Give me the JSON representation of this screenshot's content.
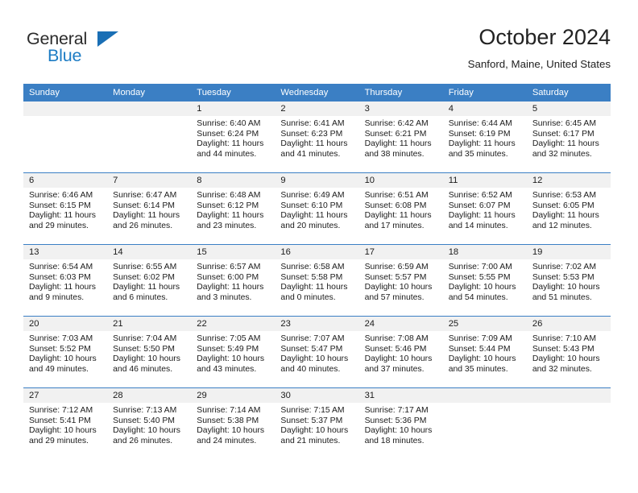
{
  "brand": {
    "word_one": "General",
    "word_two": "Blue",
    "triangle_color": "#1a6fb5"
  },
  "header": {
    "month_title": "October 2024",
    "location": "Sanford, Maine, United States"
  },
  "theme": {
    "header_blue": "#3b7fc4",
    "daynum_band": "#f1f1f1",
    "text": "#1b1b1b"
  },
  "weekday_headers": [
    "Sunday",
    "Monday",
    "Tuesday",
    "Wednesday",
    "Thursday",
    "Friday",
    "Saturday"
  ],
  "labels": {
    "sunrise_prefix": "Sunrise: ",
    "sunset_prefix": "Sunset: ",
    "daylight_prefix": "Daylight: "
  },
  "weeks": [
    [
      {
        "day": "",
        "sunrise": "",
        "sunset": "",
        "daylight_line1": "",
        "daylight_line2": ""
      },
      {
        "day": "",
        "sunrise": "",
        "sunset": "",
        "daylight_line1": "",
        "daylight_line2": ""
      },
      {
        "day": "1",
        "sunrise": "Sunrise: 6:40 AM",
        "sunset": "Sunset: 6:24 PM",
        "daylight_line1": "Daylight: 11 hours",
        "daylight_line2": "and 44 minutes."
      },
      {
        "day": "2",
        "sunrise": "Sunrise: 6:41 AM",
        "sunset": "Sunset: 6:23 PM",
        "daylight_line1": "Daylight: 11 hours",
        "daylight_line2": "and 41 minutes."
      },
      {
        "day": "3",
        "sunrise": "Sunrise: 6:42 AM",
        "sunset": "Sunset: 6:21 PM",
        "daylight_line1": "Daylight: 11 hours",
        "daylight_line2": "and 38 minutes."
      },
      {
        "day": "4",
        "sunrise": "Sunrise: 6:44 AM",
        "sunset": "Sunset: 6:19 PM",
        "daylight_line1": "Daylight: 11 hours",
        "daylight_line2": "and 35 minutes."
      },
      {
        "day": "5",
        "sunrise": "Sunrise: 6:45 AM",
        "sunset": "Sunset: 6:17 PM",
        "daylight_line1": "Daylight: 11 hours",
        "daylight_line2": "and 32 minutes."
      }
    ],
    [
      {
        "day": "6",
        "sunrise": "Sunrise: 6:46 AM",
        "sunset": "Sunset: 6:15 PM",
        "daylight_line1": "Daylight: 11 hours",
        "daylight_line2": "and 29 minutes."
      },
      {
        "day": "7",
        "sunrise": "Sunrise: 6:47 AM",
        "sunset": "Sunset: 6:14 PM",
        "daylight_line1": "Daylight: 11 hours",
        "daylight_line2": "and 26 minutes."
      },
      {
        "day": "8",
        "sunrise": "Sunrise: 6:48 AM",
        "sunset": "Sunset: 6:12 PM",
        "daylight_line1": "Daylight: 11 hours",
        "daylight_line2": "and 23 minutes."
      },
      {
        "day": "9",
        "sunrise": "Sunrise: 6:49 AM",
        "sunset": "Sunset: 6:10 PM",
        "daylight_line1": "Daylight: 11 hours",
        "daylight_line2": "and 20 minutes."
      },
      {
        "day": "10",
        "sunrise": "Sunrise: 6:51 AM",
        "sunset": "Sunset: 6:08 PM",
        "daylight_line1": "Daylight: 11 hours",
        "daylight_line2": "and 17 minutes."
      },
      {
        "day": "11",
        "sunrise": "Sunrise: 6:52 AM",
        "sunset": "Sunset: 6:07 PM",
        "daylight_line1": "Daylight: 11 hours",
        "daylight_line2": "and 14 minutes."
      },
      {
        "day": "12",
        "sunrise": "Sunrise: 6:53 AM",
        "sunset": "Sunset: 6:05 PM",
        "daylight_line1": "Daylight: 11 hours",
        "daylight_line2": "and 12 minutes."
      }
    ],
    [
      {
        "day": "13",
        "sunrise": "Sunrise: 6:54 AM",
        "sunset": "Sunset: 6:03 PM",
        "daylight_line1": "Daylight: 11 hours",
        "daylight_line2": "and 9 minutes."
      },
      {
        "day": "14",
        "sunrise": "Sunrise: 6:55 AM",
        "sunset": "Sunset: 6:02 PM",
        "daylight_line1": "Daylight: 11 hours",
        "daylight_line2": "and 6 minutes."
      },
      {
        "day": "15",
        "sunrise": "Sunrise: 6:57 AM",
        "sunset": "Sunset: 6:00 PM",
        "daylight_line1": "Daylight: 11 hours",
        "daylight_line2": "and 3 minutes."
      },
      {
        "day": "16",
        "sunrise": "Sunrise: 6:58 AM",
        "sunset": "Sunset: 5:58 PM",
        "daylight_line1": "Daylight: 11 hours",
        "daylight_line2": "and 0 minutes."
      },
      {
        "day": "17",
        "sunrise": "Sunrise: 6:59 AM",
        "sunset": "Sunset: 5:57 PM",
        "daylight_line1": "Daylight: 10 hours",
        "daylight_line2": "and 57 minutes."
      },
      {
        "day": "18",
        "sunrise": "Sunrise: 7:00 AM",
        "sunset": "Sunset: 5:55 PM",
        "daylight_line1": "Daylight: 10 hours",
        "daylight_line2": "and 54 minutes."
      },
      {
        "day": "19",
        "sunrise": "Sunrise: 7:02 AM",
        "sunset": "Sunset: 5:53 PM",
        "daylight_line1": "Daylight: 10 hours",
        "daylight_line2": "and 51 minutes."
      }
    ],
    [
      {
        "day": "20",
        "sunrise": "Sunrise: 7:03 AM",
        "sunset": "Sunset: 5:52 PM",
        "daylight_line1": "Daylight: 10 hours",
        "daylight_line2": "and 49 minutes."
      },
      {
        "day": "21",
        "sunrise": "Sunrise: 7:04 AM",
        "sunset": "Sunset: 5:50 PM",
        "daylight_line1": "Daylight: 10 hours",
        "daylight_line2": "and 46 minutes."
      },
      {
        "day": "22",
        "sunrise": "Sunrise: 7:05 AM",
        "sunset": "Sunset: 5:49 PM",
        "daylight_line1": "Daylight: 10 hours",
        "daylight_line2": "and 43 minutes."
      },
      {
        "day": "23",
        "sunrise": "Sunrise: 7:07 AM",
        "sunset": "Sunset: 5:47 PM",
        "daylight_line1": "Daylight: 10 hours",
        "daylight_line2": "and 40 minutes."
      },
      {
        "day": "24",
        "sunrise": "Sunrise: 7:08 AM",
        "sunset": "Sunset: 5:46 PM",
        "daylight_line1": "Daylight: 10 hours",
        "daylight_line2": "and 37 minutes."
      },
      {
        "day": "25",
        "sunrise": "Sunrise: 7:09 AM",
        "sunset": "Sunset: 5:44 PM",
        "daylight_line1": "Daylight: 10 hours",
        "daylight_line2": "and 35 minutes."
      },
      {
        "day": "26",
        "sunrise": "Sunrise: 7:10 AM",
        "sunset": "Sunset: 5:43 PM",
        "daylight_line1": "Daylight: 10 hours",
        "daylight_line2": "and 32 minutes."
      }
    ],
    [
      {
        "day": "27",
        "sunrise": "Sunrise: 7:12 AM",
        "sunset": "Sunset: 5:41 PM",
        "daylight_line1": "Daylight: 10 hours",
        "daylight_line2": "and 29 minutes."
      },
      {
        "day": "28",
        "sunrise": "Sunrise: 7:13 AM",
        "sunset": "Sunset: 5:40 PM",
        "daylight_line1": "Daylight: 10 hours",
        "daylight_line2": "and 26 minutes."
      },
      {
        "day": "29",
        "sunrise": "Sunrise: 7:14 AM",
        "sunset": "Sunset: 5:38 PM",
        "daylight_line1": "Daylight: 10 hours",
        "daylight_line2": "and 24 minutes."
      },
      {
        "day": "30",
        "sunrise": "Sunrise: 7:15 AM",
        "sunset": "Sunset: 5:37 PM",
        "daylight_line1": "Daylight: 10 hours",
        "daylight_line2": "and 21 minutes."
      },
      {
        "day": "31",
        "sunrise": "Sunrise: 7:17 AM",
        "sunset": "Sunset: 5:36 PM",
        "daylight_line1": "Daylight: 10 hours",
        "daylight_line2": "and 18 minutes."
      },
      {
        "day": "",
        "sunrise": "",
        "sunset": "",
        "daylight_line1": "",
        "daylight_line2": ""
      },
      {
        "day": "",
        "sunrise": "",
        "sunset": "",
        "daylight_line1": "",
        "daylight_line2": ""
      }
    ]
  ]
}
